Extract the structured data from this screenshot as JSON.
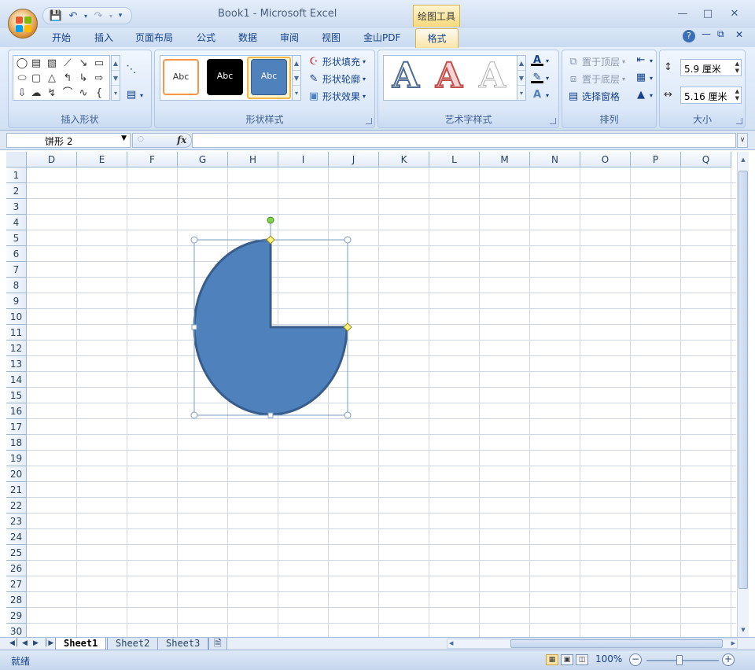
{
  "window": {
    "title": "Book1 - Microsoft Excel",
    "context_tab_header": "绘图工具"
  },
  "ribbon_tabs": [
    "开始",
    "插入",
    "页面布局",
    "公式",
    "数据",
    "审阅",
    "视图",
    "金山PDF",
    "格式"
  ],
  "ribbon": {
    "groups": {
      "insert_shapes": "插入形状",
      "shape_styles": "形状样式",
      "wordart_styles": "艺术字样式",
      "arrange": "排列",
      "size": "大小"
    },
    "style_sample_text": "Abc",
    "shape_fill": "形状填充",
    "shape_outline": "形状轮廓",
    "shape_effects": "形状效果",
    "bring_to_front": "置于顶层",
    "send_to_back": "置于底层",
    "selection_pane": "选择窗格",
    "height_value": "5.9 厘米",
    "width_value": "5.16 厘米",
    "wordart_letter": "A"
  },
  "formula_bar": {
    "name_box": "饼形 2",
    "fx": "fx",
    "content": ""
  },
  "columns": [
    "D",
    "E",
    "F",
    "G",
    "H",
    "I",
    "J",
    "K",
    "L",
    "M",
    "N",
    "O",
    "P",
    "Q"
  ],
  "rows": [
    "1",
    "2",
    "3",
    "4",
    "5",
    "6",
    "7",
    "8",
    "9",
    "10",
    "11",
    "12",
    "13",
    "14",
    "15",
    "16",
    "17",
    "18",
    "19",
    "20",
    "21",
    "22",
    "23",
    "24",
    "25",
    "26",
    "27",
    "28",
    "29",
    "30"
  ],
  "sheet_tabs": [
    "Sheet1",
    "Sheet2",
    "Sheet3"
  ],
  "active_sheet": "Sheet1",
  "status": {
    "ready": "就绪",
    "zoom": "100%"
  },
  "colors": {
    "shape_fill": "#4f81bd",
    "shape_outline": "#385d8a",
    "accent_orange": "#f79646"
  }
}
